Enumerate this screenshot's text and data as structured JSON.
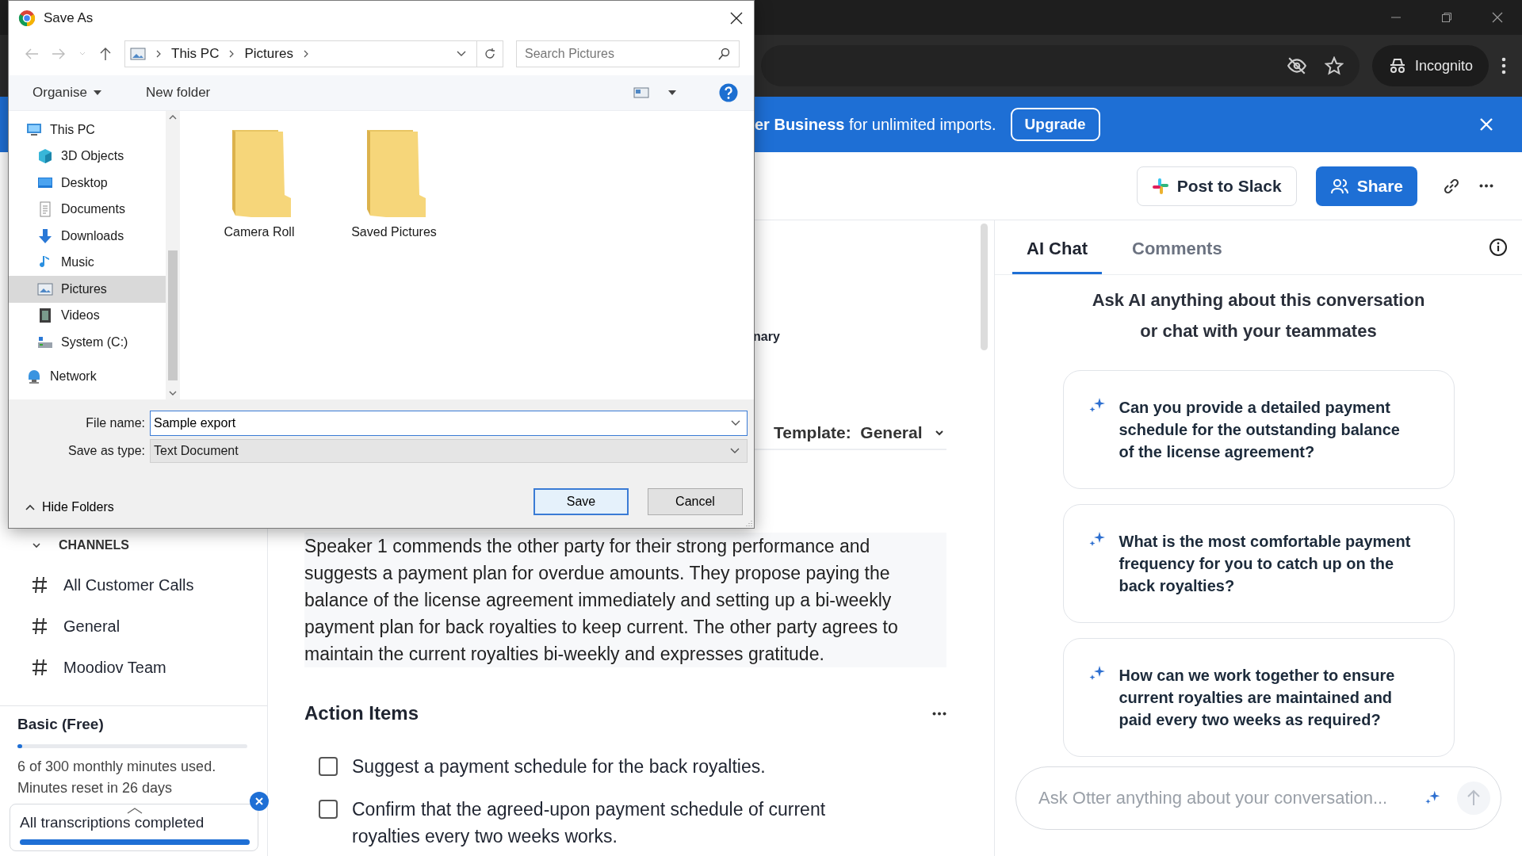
{
  "browser": {
    "incognito_label": "Incognito"
  },
  "banner": {
    "text": "**er Business** for unlimited imports.",
    "button": "Upgrade"
  },
  "header": {
    "buttons": [
      {
        "label": "Post to Slack",
        "kind": "slack"
      },
      {
        "label": "Share",
        "kind": "share"
      }
    ]
  },
  "sidebar": {
    "section": "CHANNELS",
    "expanded": true,
    "channels": [
      {
        "label": "All Customer Calls"
      },
      {
        "label": "General"
      },
      {
        "label": "Moodiov Team"
      }
    ],
    "plan": {
      "title": "Basic (Free)",
      "level": 0.02,
      "usage": "6 of 300 monthly minutes used.",
      "reset": "Minutes reset in 26 days"
    },
    "toast": {
      "text": "All transcriptions completed",
      "level": 1
    }
  },
  "main": {
    "tab_fragment": "nary",
    "template": {
      "label": "Template:",
      "value": "General"
    },
    "summary": "Speaker 1 commends the other party for their strong performance and suggests a payment plan for overdue amounts. They propose paying the balance of the license agreement immediately and setting up a bi-weekly payment plan for back royalties to keep current. The other party agrees to maintain the current royalties bi-weekly and expresses gratitude.",
    "action_items": {
      "title": "Action Items",
      "items": [
        {
          "text": "Suggest a payment schedule for the back royalties.",
          "checked": false
        },
        {
          "text": "Confirm that the agreed-upon payment schedule of current royalties every two weeks works.",
          "checked": false
        }
      ]
    }
  },
  "ai_panel": {
    "tabs": [
      {
        "label": "AI Chat",
        "selected": true
      },
      {
        "label": "Comments",
        "selected": false
      }
    ],
    "heading": [
      "Ask AI anything about this conversation",
      "or chat with your teammates"
    ],
    "suggestions": [
      {
        "text": "Can you provide a detailed payment schedule for the outstanding balance of the license agreement?"
      },
      {
        "text": "What is the most comfortable payment frequency for you to catch up on the back royalties?"
      },
      {
        "text": "How can we work together to ensure current royalties are maintained and paid every two weeks as required?"
      }
    ],
    "input": {
      "placeholder": "Ask Otter anything about your conversation..."
    }
  },
  "dialog": {
    "title": "Save As",
    "breadcrumb": [
      "This PC",
      "Pictures"
    ],
    "search": {
      "placeholder": "Search Pictures"
    },
    "toolbar": [
      {
        "label": "Organise",
        "kind": "menu"
      },
      {
        "label": "New folder",
        "kind": "plain"
      }
    ],
    "tree": [
      {
        "label": "This PC",
        "kind": "pc",
        "selected": false,
        "children": [
          {
            "label": "3D Objects",
            "kind": "objects",
            "selected": false
          },
          {
            "label": "Desktop",
            "kind": "desktop",
            "selected": false
          },
          {
            "label": "Documents",
            "kind": "documents",
            "selected": false
          },
          {
            "label": "Downloads",
            "kind": "downloads",
            "selected": false
          },
          {
            "label": "Music",
            "kind": "music",
            "selected": false
          },
          {
            "label": "Pictures",
            "kind": "pictures",
            "selected": true
          },
          {
            "label": "Videos",
            "kind": "videos",
            "selected": false
          },
          {
            "label": "System (C:)",
            "kind": "drive",
            "selected": false
          }
        ]
      },
      {
        "label": "Network",
        "kind": "network",
        "selected": false
      }
    ],
    "folders": [
      {
        "label": "Camera Roll"
      },
      {
        "label": "Saved Pictures"
      }
    ],
    "file_name": {
      "label": "File name:",
      "value": "Sample export"
    },
    "save_type": {
      "label": "Save as type:",
      "value": "Text Document"
    },
    "hide_folders": "Hide Folders",
    "buttons": [
      {
        "label": "Save",
        "kind": "default"
      },
      {
        "label": "Cancel",
        "kind": "normal"
      }
    ]
  }
}
